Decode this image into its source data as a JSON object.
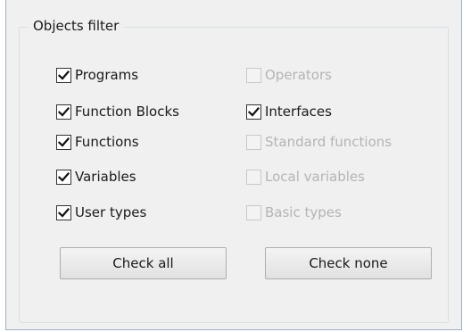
{
  "group": {
    "title": "Objects filter"
  },
  "left_column": [
    {
      "label": "Programs",
      "checked": true,
      "enabled": true
    },
    {
      "label": "Function Blocks",
      "checked": true,
      "enabled": true
    },
    {
      "label": "Functions",
      "checked": true,
      "enabled": true
    },
    {
      "label": "Variables",
      "checked": true,
      "enabled": true
    },
    {
      "label": "User types",
      "checked": true,
      "enabled": true
    }
  ],
  "right_column": [
    {
      "label": "Operators",
      "checked": false,
      "enabled": false
    },
    {
      "label": "Interfaces",
      "checked": true,
      "enabled": true
    },
    {
      "label": "Standard functions",
      "checked": false,
      "enabled": false
    },
    {
      "label": "Local variables",
      "checked": false,
      "enabled": false
    },
    {
      "label": "Basic types",
      "checked": false,
      "enabled": false
    }
  ],
  "buttons": {
    "check_all": "Check all",
    "check_none": "Check none"
  },
  "colors": {
    "background": "#f0f0f0",
    "group_border": "#d5dfe5",
    "disabled_text": "#b4b4b4"
  },
  "icons": {
    "check": "checkmark-icon"
  }
}
